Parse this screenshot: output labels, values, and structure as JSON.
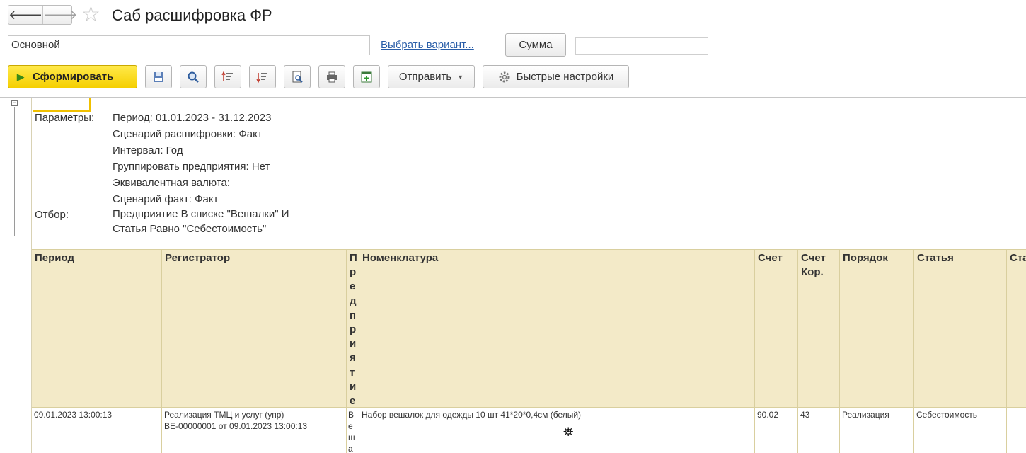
{
  "header": {
    "back_icon": "arrow-left-icon",
    "forward_icon": "arrow-right-icon",
    "back_glyph": "🡐",
    "forward_glyph": "🡒",
    "star_glyph": "☆",
    "title": "Саб расшифровка ФР"
  },
  "variant": {
    "value": "Основной",
    "choose_link": "Выбрать вариант...",
    "sum_button": "Сумма",
    "sum_value": ""
  },
  "toolbar": {
    "generate_label": "Сформировать",
    "send_label": "Отправить",
    "quick_settings_label": "Быстрые настройки",
    "accent_color": "#f5cf00"
  },
  "params": {
    "label": "Параметры:",
    "period": "Период: 01.01.2023 - 31.12.2023",
    "scenario": "Сценарий расшифровки: Факт",
    "interval": "Интервал: Год",
    "group": "Группировать предприятия: Нет",
    "currency": "Эквивалентная валюта:",
    "fact_scenario": "Сценарий факт: Факт",
    "filter_label": "Отбор:",
    "filter_line1": "Предприятие В списке \"Вешалки\" И",
    "filter_line2": "Статья Равно \"Себестоимость\""
  },
  "table": {
    "columns": {
      "period": "Период",
      "registrar": "Регистратор",
      "enterprise": "Предприятие",
      "nomenclature": "Номенклатура",
      "account": "Счет",
      "account_corr": "Счет Кор.",
      "order": "Порядок",
      "article": "Статья",
      "next": "Ста"
    },
    "row1": {
      "period": "09.01.2023 13:00:13",
      "registrar_line1": "Реализация ТМЦ и услуг (упр)",
      "registrar_line2": "ВЕ-00000001 от 09.01.2023 13:00:13",
      "enterprise": "Веша",
      "nomenclature": "Набор вешалок для одежды 10 шт 41*20*0,4см (белый)",
      "account": "90.02",
      "account_corr": "43",
      "order": "Реализация",
      "article": "Себестоимость"
    }
  }
}
